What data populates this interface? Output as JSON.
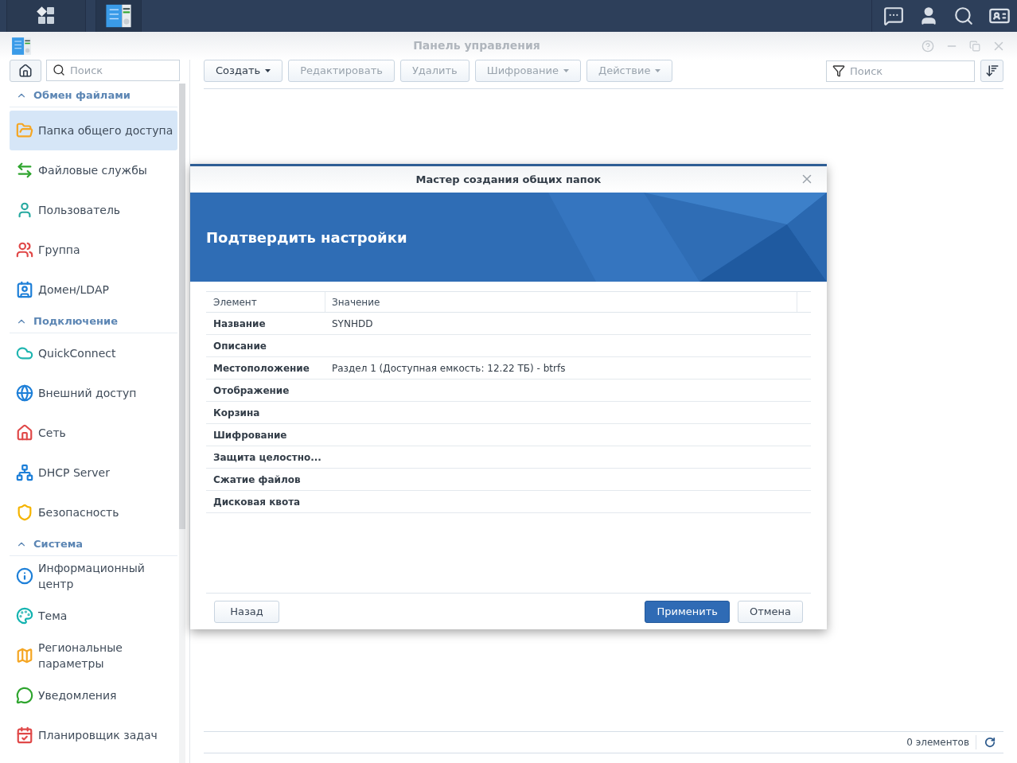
{
  "window": {
    "title": "Панель управления"
  },
  "sidebar": {
    "search": {
      "placeholder": "Поиск"
    },
    "sections": [
      {
        "title": "Обмен файлами",
        "expanded": true,
        "items": [
          {
            "label": "Папка общего доступа",
            "selected": true
          },
          {
            "label": "Файловые службы",
            "selected": false
          },
          {
            "label": "Пользователь",
            "selected": false
          },
          {
            "label": "Группа",
            "selected": false
          },
          {
            "label": "Домен/LDAP",
            "selected": false
          }
        ]
      },
      {
        "title": "Подключение",
        "expanded": true,
        "items": [
          {
            "label": "QuickConnect",
            "selected": false
          },
          {
            "label": "Внешний доступ",
            "selected": false
          },
          {
            "label": "Сеть",
            "selected": false
          },
          {
            "label": "DHCP Server",
            "selected": false
          },
          {
            "label": "Безопасность",
            "selected": false
          }
        ]
      },
      {
        "title": "Система",
        "expanded": true,
        "items": [
          {
            "label": "Информационный центр",
            "selected": false
          },
          {
            "label": "Тема",
            "selected": false
          },
          {
            "label": "Региональные параметры",
            "selected": false
          },
          {
            "label": "Уведомления",
            "selected": false
          },
          {
            "label": "Планировщик задач",
            "selected": false
          }
        ]
      }
    ]
  },
  "toolbar": {
    "buttons": [
      {
        "label": "Создать",
        "disabled": false,
        "dropdown": true
      },
      {
        "label": "Редактировать",
        "disabled": true,
        "dropdown": false
      },
      {
        "label": "Удалить",
        "disabled": true,
        "dropdown": false
      },
      {
        "label": "Шифрование",
        "disabled": true,
        "dropdown": true
      },
      {
        "label": "Действие",
        "disabled": true,
        "dropdown": true
      }
    ],
    "filter": {
      "placeholder": "Поиск"
    }
  },
  "status_bar": {
    "count": "0 элементов"
  },
  "dialog": {
    "title": "Мастер создания общих папок",
    "heading": "Подтвердить настройки",
    "table": {
      "columns": [
        "Элемент",
        "Значение"
      ],
      "rows": [
        {
          "name": "Название",
          "value": "SYNHDD"
        },
        {
          "name": "Описание",
          "value": ""
        },
        {
          "name": "Местоположение",
          "value": "Раздел 1 (Доступная емкость: 12.22 ТБ) - btrfs"
        },
        {
          "name": "Отображение",
          "value": ""
        },
        {
          "name": "Корзина",
          "value": ""
        },
        {
          "name": "Шифрование",
          "value": ""
        },
        {
          "name": "Защита целостно...",
          "value": ""
        },
        {
          "name": "Сжатие файлов",
          "value": ""
        },
        {
          "name": "Дисковая квота",
          "value": ""
        }
      ]
    },
    "buttons": [
      {
        "label": "Назад",
        "kind": "secondary"
      },
      {
        "label": "Применить",
        "kind": "primary"
      },
      {
        "label": "Отмена",
        "kind": "secondary"
      }
    ]
  }
}
